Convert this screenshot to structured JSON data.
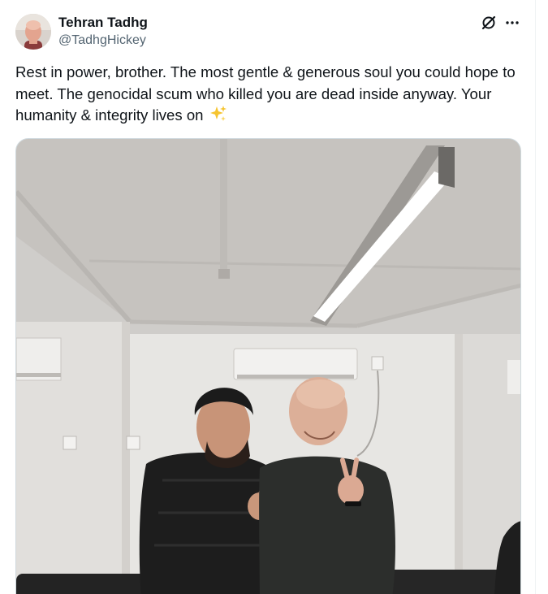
{
  "author": {
    "name": "Tehran Tadhg",
    "handle": "@TadhgHickey"
  },
  "icons": {
    "avatar": "profile-photo",
    "grok": "grok-slash-icon",
    "more": "more-horizontal-icon",
    "sparkle": "sparkles-emoji"
  },
  "post": {
    "text": "Rest in power, brother. The most gentle & generous soul you could hope to meet. The genocidal scum who killed you are dead inside anyway. Your humanity & integrity lives on",
    "emoji": "✨"
  },
  "colors": {
    "text": "#0f1419",
    "secondary": "#536471",
    "border": "#cfd9de"
  }
}
